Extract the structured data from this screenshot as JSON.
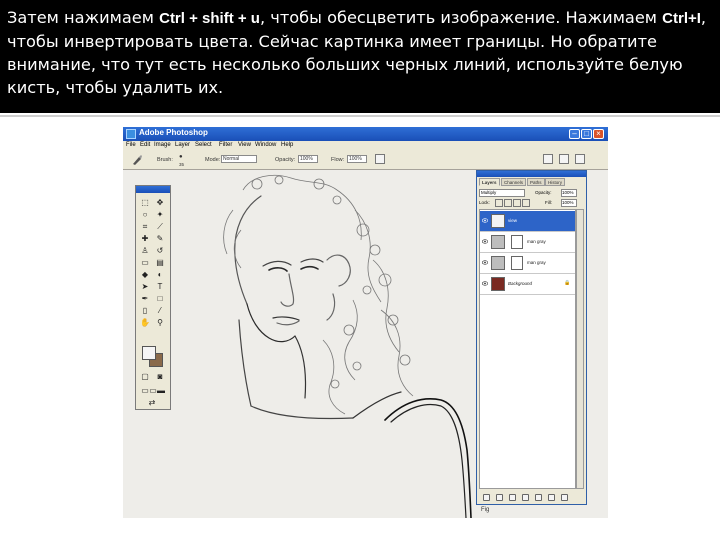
{
  "slide": {
    "text_part1": "Затем нажимаем ",
    "key1": "Ctrl + shift + u",
    "text_part2": ", чтобы обесцветить изображение. Нажимаем ",
    "key2": "Ctrl+I",
    "text_part3": ", чтобы инвертировать цвета. Сейчас картинка имеет границы. Но обратите внимание, что тут есть несколько больших черных линий, используйте белую кисть, чтобы удалить их."
  },
  "photoshop": {
    "window_title": "Adobe Photoshop",
    "menu": [
      "File",
      "Edit",
      "Image",
      "Layer",
      "Select",
      "Filter",
      "View",
      "Window",
      "Help"
    ],
    "options": {
      "brush_label": "Brush:",
      "brush_size": "35",
      "mode_label": "Mode:",
      "mode_value": "Normal",
      "opacity_label": "Opacity:",
      "opacity_value": "100%",
      "flow_label": "Flow:",
      "flow_value": "100%"
    },
    "layers_panel": {
      "tabs": [
        "Layers",
        "Channels",
        "Paths",
        "History"
      ],
      "blend_mode": "Multiply",
      "opacity_label": "Opacity:",
      "opacity_value": "100%",
      "lock_label": "Lock:",
      "fill_label": "Fill:",
      "fill_value": "100%",
      "layers": [
        {
          "name": "view",
          "selected": true
        },
        {
          "name": "man gray",
          "selected": false
        },
        {
          "name": "man gray",
          "selected": false
        },
        {
          "name": "Background",
          "selected": false
        }
      ]
    },
    "status_fragment": "Fig"
  },
  "colors": {
    "slide_header_bg": "#000000",
    "slide_text": "#ffffff",
    "titlebar_blue": "#1a4fb7",
    "selected_layer": "#2d64c8",
    "background_swatch": "#8a6a4a"
  }
}
